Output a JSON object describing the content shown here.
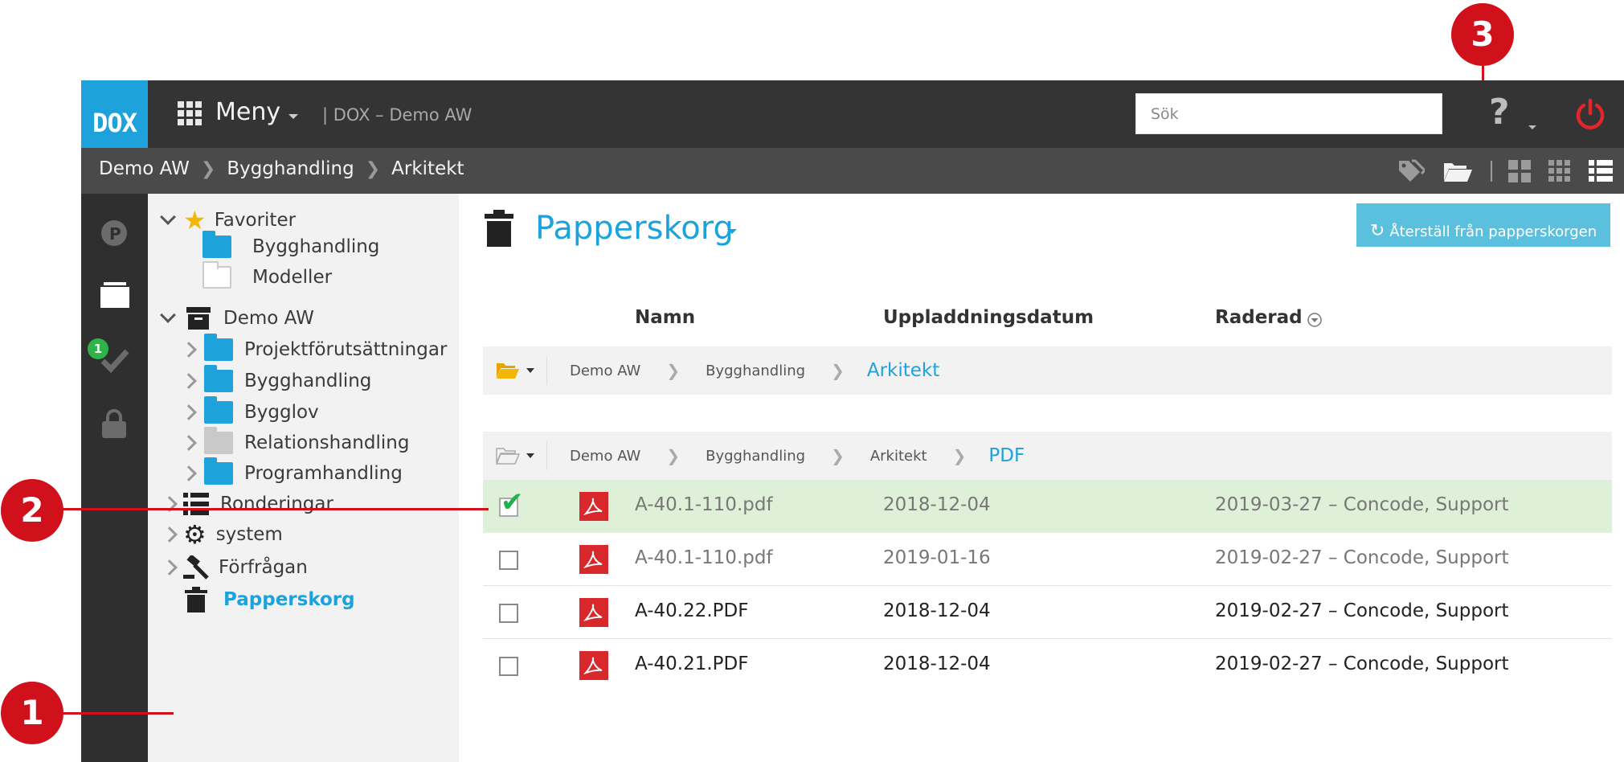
{
  "app": {
    "logo": "DOX",
    "menu_label": "Meny",
    "project_title": "| DOX – Demo AW",
    "search_placeholder": "Sök"
  },
  "breadcrumb": [
    "Demo AW",
    "Bygghandling",
    "Arkitekt"
  ],
  "tree": {
    "favorites_label": "Favoriter",
    "favorites": [
      "Bygghandling",
      "Modeller"
    ],
    "project_label": "Demo AW",
    "project_children": [
      "Projektförutsättningar",
      "Bygghandling",
      "Bygglov",
      "Relationshandling",
      "Programhandling"
    ],
    "other": [
      "Ronderingar",
      "system",
      "Förfrågan"
    ],
    "trash_label": "Papperskorg"
  },
  "rail": {
    "badge": "1"
  },
  "main": {
    "title": "Papperskorg",
    "restore_button": "Återställ från papperskorgen",
    "columns": {
      "name": "Namn",
      "uploaded": "Uppladdningsdatum",
      "deleted": "Raderad"
    },
    "path1": {
      "items": [
        "Demo AW",
        "Bygghandling"
      ],
      "current": "Arkitekt"
    },
    "path2": {
      "items": [
        "Demo AW",
        "Bygghandling",
        "Arkitekt"
      ],
      "current": "PDF"
    },
    "rows": [
      {
        "name": "A-40.1-110.pdf",
        "uploaded": "2018-12-04",
        "deleted": "2019-03-27 – Concode, Support",
        "checked": true
      },
      {
        "name": "A-40.1-110.pdf",
        "uploaded": "2019-01-16",
        "deleted": "2019-02-27 – Concode, Support",
        "checked": false
      },
      {
        "name": "A-40.22.PDF",
        "uploaded": "2018-12-04",
        "deleted": "2019-02-27 – Concode, Support",
        "checked": false
      },
      {
        "name": "A-40.21.PDF",
        "uploaded": "2018-12-04",
        "deleted": "2019-02-27 – Concode, Support",
        "checked": false
      }
    ]
  },
  "callouts": [
    "1",
    "2",
    "3"
  ],
  "colors": {
    "accent": "#1da2dc",
    "callout": "#d0111c",
    "selected_row": "#dff0d8"
  }
}
